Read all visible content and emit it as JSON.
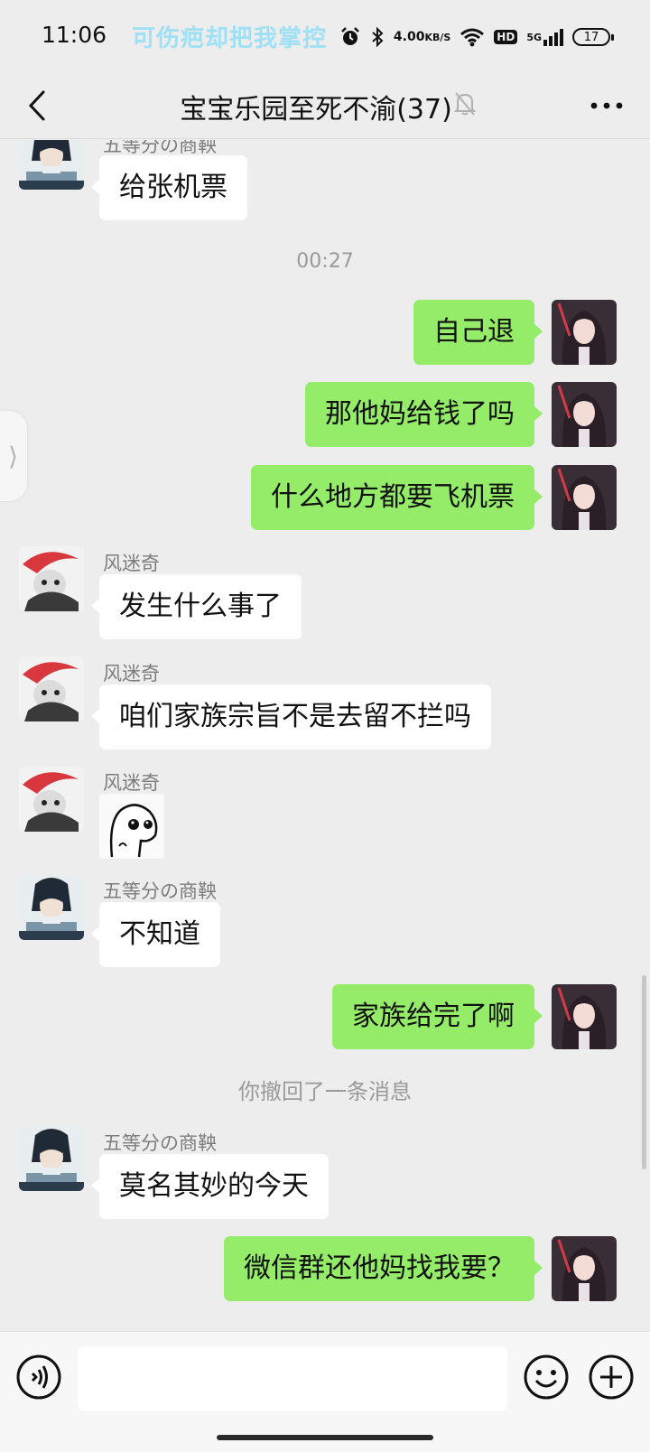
{
  "status_bar": {
    "time": "11:06",
    "banner": "可伤疤却把我掌控",
    "net_speed_value": "4.00",
    "net_speed_unit": "KB/S",
    "hd_label": "HD",
    "network_label": "5G",
    "battery_level": "17",
    "icons": [
      "alarm-icon",
      "bluetooth-icon",
      "wifi-icon",
      "hd-icon",
      "signal-icon",
      "battery-icon"
    ]
  },
  "header": {
    "title": "宝宝乐园至死不渝(37)",
    "back_icon": "chevron-left-icon",
    "mute_icon": "bell-off-icon",
    "more_icon": "more-horizontal-icon"
  },
  "chat": {
    "timestamp": "00:27",
    "recall_notice": "你撤回了一条消息",
    "messages": [
      {
        "sender": "五等分の商鞅",
        "text": "给张机票",
        "side": "left"
      },
      {
        "text": "自己退",
        "side": "right"
      },
      {
        "text": "那他妈给钱了吗",
        "side": "right"
      },
      {
        "text": "什么地方都要飞机票",
        "side": "right"
      },
      {
        "sender": "风迷奇",
        "text": "发生什么事了",
        "side": "left"
      },
      {
        "sender": "风迷奇",
        "text": "咱们家族宗旨不是去留不拦吗",
        "side": "left"
      },
      {
        "sender": "风迷奇",
        "sticker": "ghost-sticker",
        "side": "left"
      },
      {
        "sender": "五等分の商鞅",
        "text": "不知道",
        "side": "left"
      },
      {
        "text": "家族给完了啊",
        "side": "right"
      },
      {
        "sender": "五等分の商鞅",
        "text": "莫名其妙的今天",
        "side": "left"
      },
      {
        "text": "微信群还他妈找我要？",
        "side": "right"
      }
    ]
  },
  "input_bar": {
    "placeholder": "",
    "value": "",
    "icons": [
      "voice-icon",
      "emoji-icon",
      "plus-icon"
    ]
  },
  "colors": {
    "background": "#ededed",
    "my_bubble": "#95ec69",
    "other_bubble": "#ffffff",
    "banner_text": "#9fe0f4"
  }
}
